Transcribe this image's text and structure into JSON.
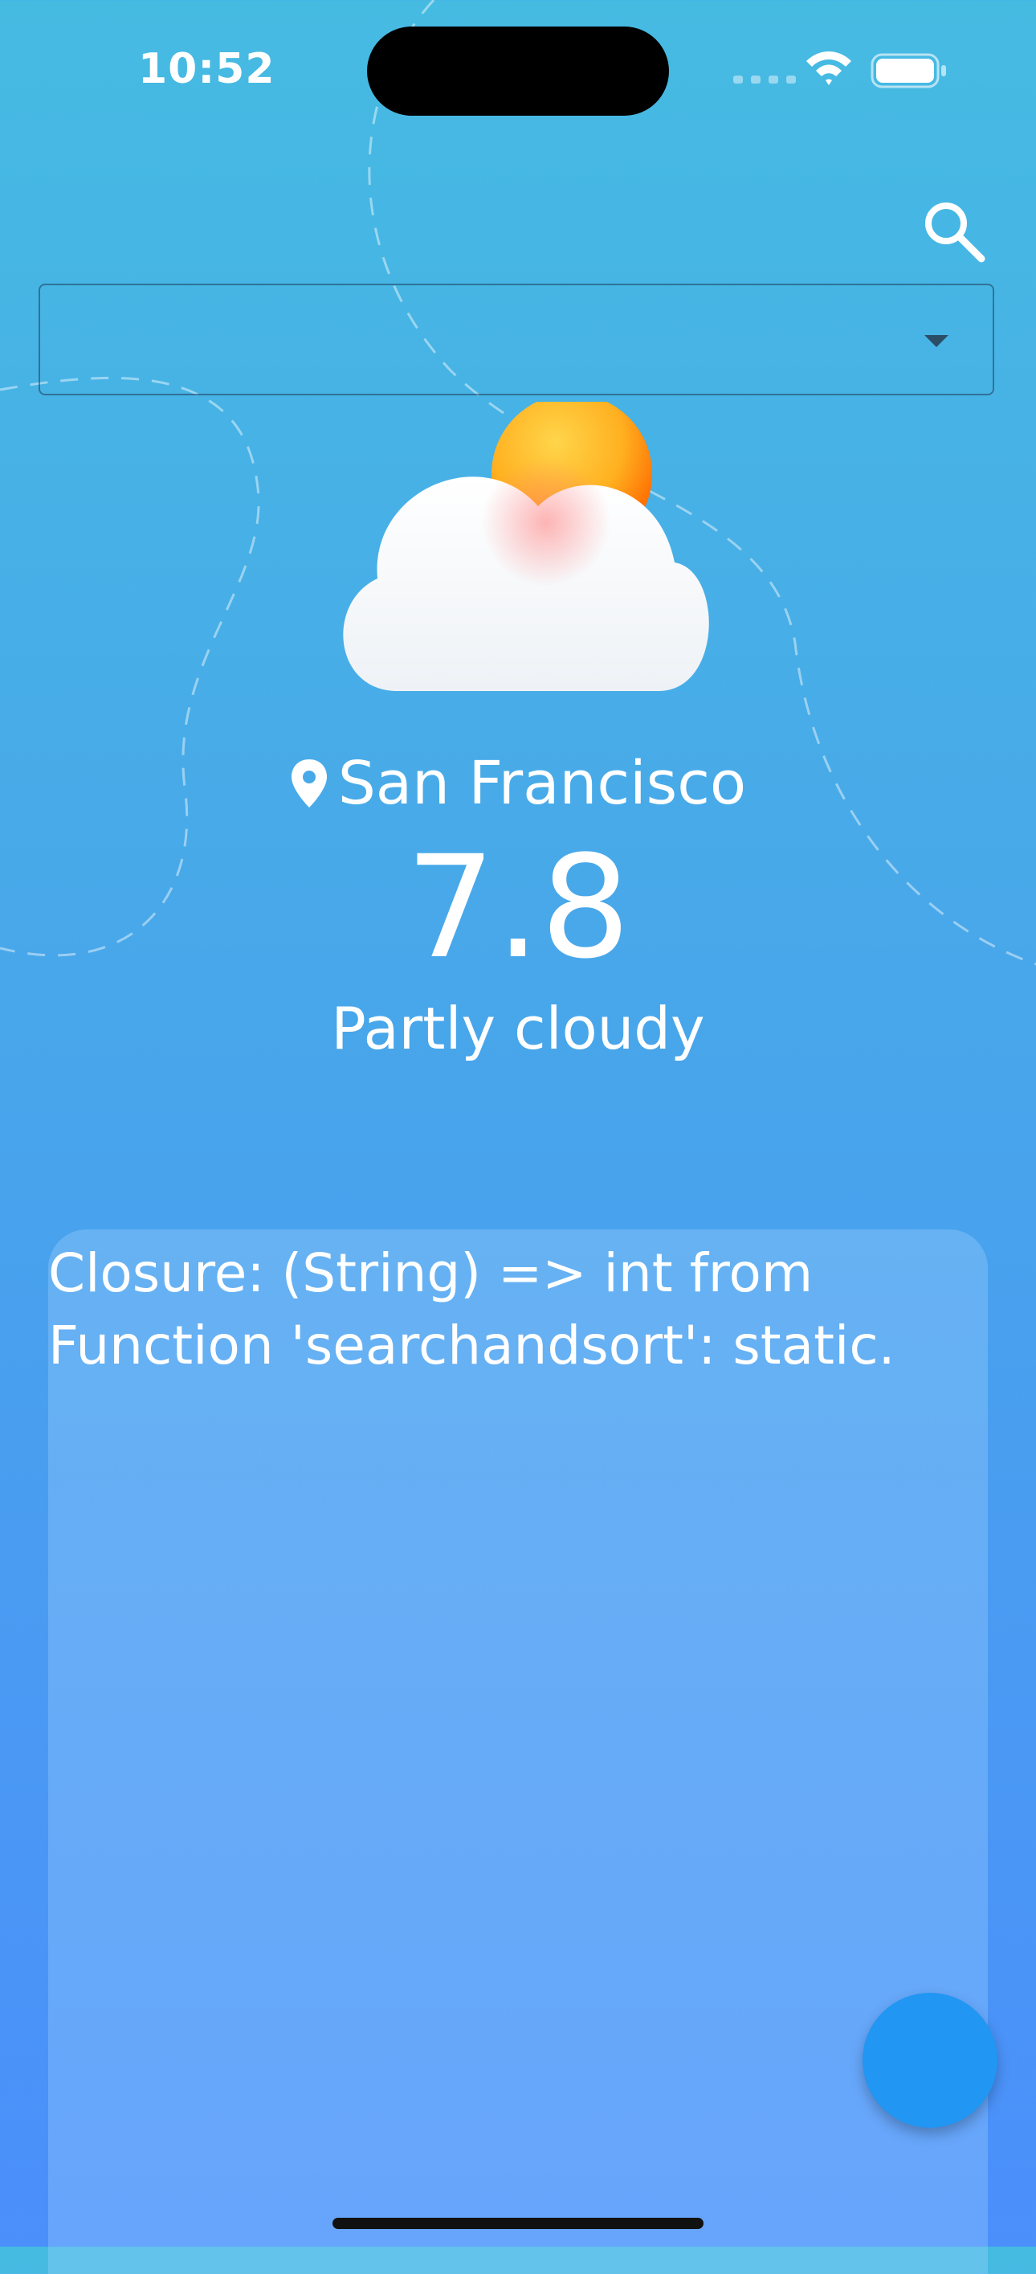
{
  "status_bar": {
    "time": "10:52"
  },
  "search": {
    "icon": "search-icon"
  },
  "dropdown": {
    "selected_value": "",
    "icon": "arrow-drop-down-icon"
  },
  "weather": {
    "icon": "partly-cloudy-icon",
    "location_icon": "location-pin-icon",
    "location": "San Francisco",
    "temperature": "7.8",
    "condition": "Partly cloudy"
  },
  "panel": {
    "text": "Closure: (String) => int from\nFunction 'searchandsort': static."
  },
  "colors": {
    "background_top": "#46bbe2",
    "background_bottom": "#4b8ffb",
    "fab": "#2196f3"
  }
}
